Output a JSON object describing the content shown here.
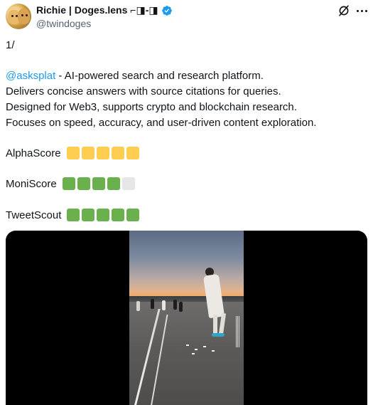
{
  "author": {
    "display_name": "Richie | Doges.lens ⌐◨-◨",
    "handle": "@twindoges",
    "verified": true,
    "verified_color": "#1d9bf0"
  },
  "header_icons": [
    "grok-icon",
    "more-icon"
  ],
  "body": {
    "line1": "1/",
    "mention": "@asksplat",
    "line2_rest": " - AI-powered search and research platform.",
    "line3": "Delivers concise answers with source citations for queries.",
    "line4": "Designed for Web3, supports crypto and blockchain research.",
    "line5": "Focuses on speed, accuracy, and user-driven content exploration."
  },
  "scores": [
    {
      "label": "AlphaScore",
      "filled": 5,
      "total": 5,
      "color": "#ffcd4f"
    },
    {
      "label": "MoniScore",
      "filled": 4,
      "total": 5,
      "color": "#6ab04c"
    },
    {
      "label": "TweetScout",
      "filled": 5,
      "total": 5,
      "color": "#6ab04c"
    }
  ],
  "colors": {
    "mention": "#1d9bf0",
    "text": "#0f1419",
    "secondary": "#536471",
    "empty_square": "#e4e6e8"
  }
}
